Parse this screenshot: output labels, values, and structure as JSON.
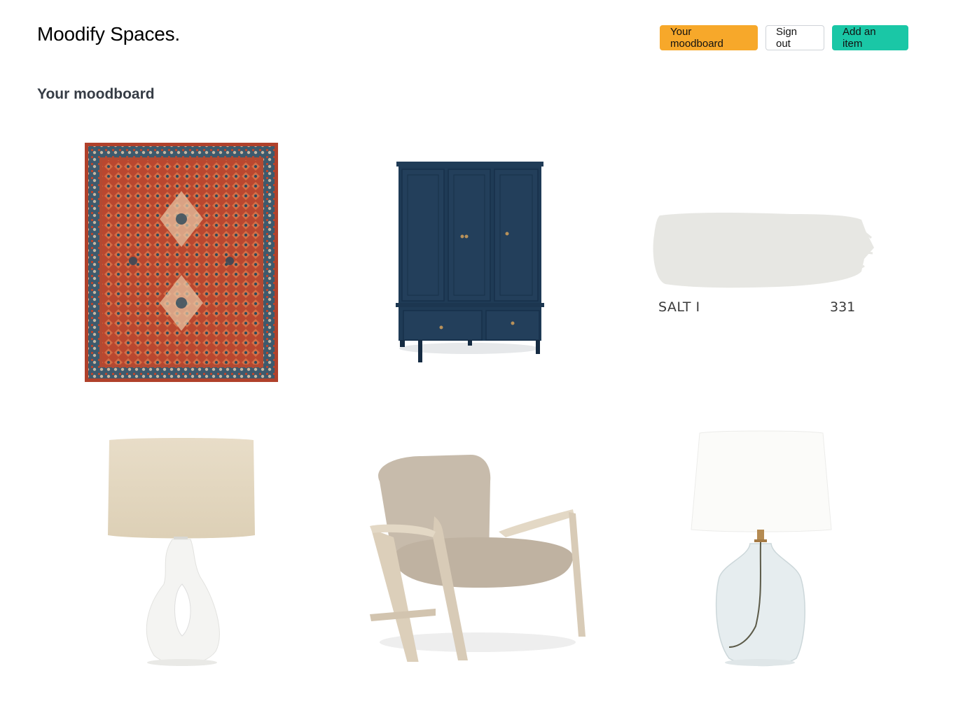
{
  "header": {
    "logo": "Moodify Spaces.",
    "buttons": {
      "moodboard": "Your moodboard",
      "sign_out": "Sign out",
      "add_item": "Add an item"
    }
  },
  "main": {
    "title": "Your moodboard",
    "items": [
      {
        "kind": "rug-image"
      },
      {
        "kind": "wardrobe-image"
      },
      {
        "kind": "paint-swatch",
        "name": "SALT I",
        "code": "331",
        "color": "#e7e7e3"
      },
      {
        "kind": "table-lamp-image"
      },
      {
        "kind": "armchair-image"
      },
      {
        "kind": "glass-lamp-image"
      }
    ]
  },
  "colors": {
    "orange": "#f7a82a",
    "teal": "#1ac7a6",
    "rug": "#b8452f",
    "wardrobe": "#1f3b56"
  }
}
